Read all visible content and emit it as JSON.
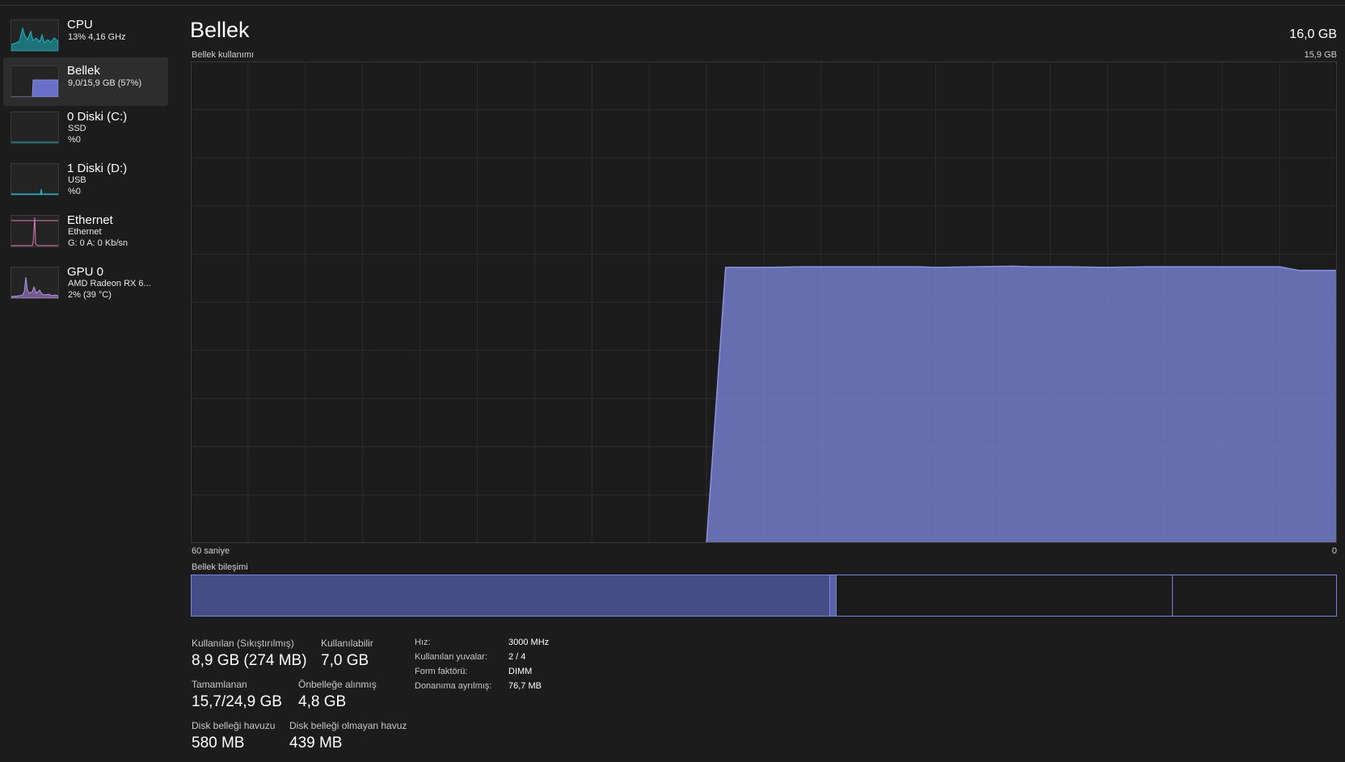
{
  "sidebar": {
    "items": [
      {
        "title": "CPU",
        "sub1": "13%  4,16 GHz",
        "sub2": "",
        "color": "#1ab4c2"
      },
      {
        "title": "Bellek",
        "sub1": "9,0/15,9 GB (57%)",
        "sub2": "",
        "color": "#7a83d6"
      },
      {
        "title": "0 Diski (C:)",
        "sub1": "SSD",
        "sub2": "%0",
        "color": "#1ab4c2"
      },
      {
        "title": "1 Diski (D:)",
        "sub1": "USB",
        "sub2": "%0",
        "color": "#1ab4c2"
      },
      {
        "title": "Ethernet",
        "sub1": "Ethernet",
        "sub2": "G: 0 A: 0 Kb/sn",
        "color": "#e07bb8"
      },
      {
        "title": "GPU 0",
        "sub1": "AMD Radeon RX 6...",
        "sub2": "2%  (39 °C)",
        "color": "#a47fd6"
      }
    ]
  },
  "main": {
    "title": "Bellek",
    "total": "16,0 GB",
    "graph_label": "Bellek kullanımı",
    "graph_max": "15,9 GB",
    "axis_left": "60 saniye",
    "axis_right": "0",
    "composition_label": "Bellek bileşimi"
  },
  "chart_data": {
    "type": "area",
    "title": "Bellek kullanımı",
    "xlabel": "60 saniye",
    "ylabel": "",
    "x_range": [
      60,
      0
    ],
    "ylim": [
      0,
      15.9
    ],
    "grid": true,
    "color": "#7a83d6",
    "x": [
      60,
      33,
      32,
      30,
      28,
      26,
      24,
      22,
      21,
      19,
      17,
      16,
      14,
      12,
      10,
      8,
      6,
      4,
      3,
      2,
      1,
      0
    ],
    "values": [
      0,
      0,
      9.1,
      9.1,
      9.12,
      9.12,
      9.12,
      9.12,
      9.1,
      9.12,
      9.14,
      9.12,
      9.12,
      9.1,
      9.12,
      9.12,
      9.12,
      9.12,
      9.12,
      9.0,
      9.0,
      9.0
    ]
  },
  "composition": {
    "used_pct": 55.7,
    "modified_pct": 0.6,
    "standby_pct": 29.3,
    "free_pct": 14.4
  },
  "stats": {
    "in_use_label": "Kullanılan (Sıkıştırılmış)",
    "in_use_value": "8,9 GB (274 MB)",
    "available_label": "Kullanılabilir",
    "available_value": "7,0 GB",
    "committed_label": "Tamamlanan",
    "committed_value": "15,7/24,9 GB",
    "cached_label": "Önbelleğe alınmış",
    "cached_value": "4,8 GB",
    "paged_label": "Disk belleği havuzu",
    "paged_value": "580 MB",
    "nonpaged_label": "Disk belleği olmayan havuz",
    "nonpaged_value": "439 MB"
  },
  "details": [
    {
      "key": "Hız:",
      "value": "3000 MHz"
    },
    {
      "key": "Kullanılan yuvalar:",
      "value": "2 / 4"
    },
    {
      "key": "Form faktörü:",
      "value": "DIMM"
    },
    {
      "key": "Donanıma ayrılmış:",
      "value": "76,7 MB"
    }
  ]
}
